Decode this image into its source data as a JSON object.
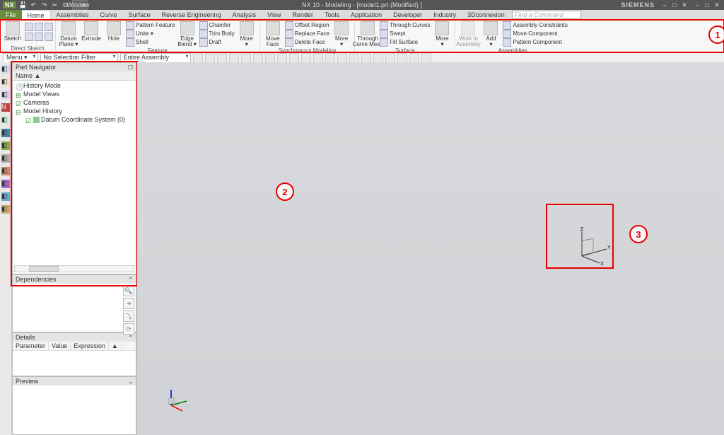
{
  "titlebar": {
    "nx": "NX",
    "qat_window": "Window",
    "center": "NX 10 - Modeling - [model1.prt (Modified) ]",
    "siemens": "SIEMENS"
  },
  "tabs": {
    "file": "File",
    "items": [
      "Home",
      "Assemblies",
      "Curve",
      "Surface",
      "Reverse Engineering",
      "Analysis",
      "View",
      "Render",
      "Tools",
      "Application",
      "Developer",
      "Industry",
      "3Dconnexion"
    ],
    "find_placeholder": "Find a Command"
  },
  "ribbon": {
    "sketch": {
      "label": "Sketch",
      "group": "Direct Sketch"
    },
    "feature": {
      "datum": "Datum\nPlane ▾",
      "extrude": "Extrude",
      "hole": "Hole",
      "pattern": "Pattern Feature",
      "unite": "Unite ▾",
      "shell": "Shell",
      "edge": "Edge\nBlend ▾",
      "chamfer": "Chamfer",
      "trim": "Trim Body",
      "draft": "Draft",
      "more": "More\n▾",
      "group": "Feature"
    },
    "sync": {
      "move": "Move\nFace",
      "offset": "Offset Region",
      "replace": "Replace Face",
      "delete": "Delete Face",
      "more": "More\n▾",
      "group": "Synchronous Modeling"
    },
    "surface": {
      "through": "Through\nCurve Mesh",
      "tcurves": "Through Curves",
      "swept": "Swept",
      "fill": "Fill Surface",
      "more": "More\n▾",
      "group": "Surface"
    },
    "assem": {
      "work": "Work in\nAssembly",
      "add": "Add\n▾",
      "constraints": "Assembly Constraints",
      "movecomp": "Move Component",
      "pattcomp": "Pattern Component",
      "group": "Assemblies"
    }
  },
  "toolbar": {
    "menu": "Menu ▾",
    "nosel": "No Selection Filter",
    "entire": "Entire Assembly"
  },
  "nav": {
    "title": "Part Navigator",
    "col": "Name   ▲",
    "items": [
      {
        "icon": "clock",
        "label": "History Mode"
      },
      {
        "icon": "plus",
        "label": "Model Views",
        "color": "#1a7a1a"
      },
      {
        "icon": "check",
        "label": "Cameras",
        "color": "#1a7a1a"
      },
      {
        "icon": "minus",
        "label": "Model History",
        "color": "#1a7a1a"
      },
      {
        "icon": "datum",
        "label": "Datum Coordinate System (0)",
        "indent": true,
        "checked": true
      }
    ]
  },
  "deps": {
    "title": "Dependencies"
  },
  "details": {
    "title": "Details",
    "cols": [
      "Parameter",
      "Value",
      "Expression",
      "▲"
    ]
  },
  "preview": {
    "title": "Preview"
  },
  "annotations": {
    "1": "1",
    "2": "2",
    "3": "3"
  },
  "axes": {
    "x": "X",
    "y": "Y",
    "z": "Z"
  }
}
